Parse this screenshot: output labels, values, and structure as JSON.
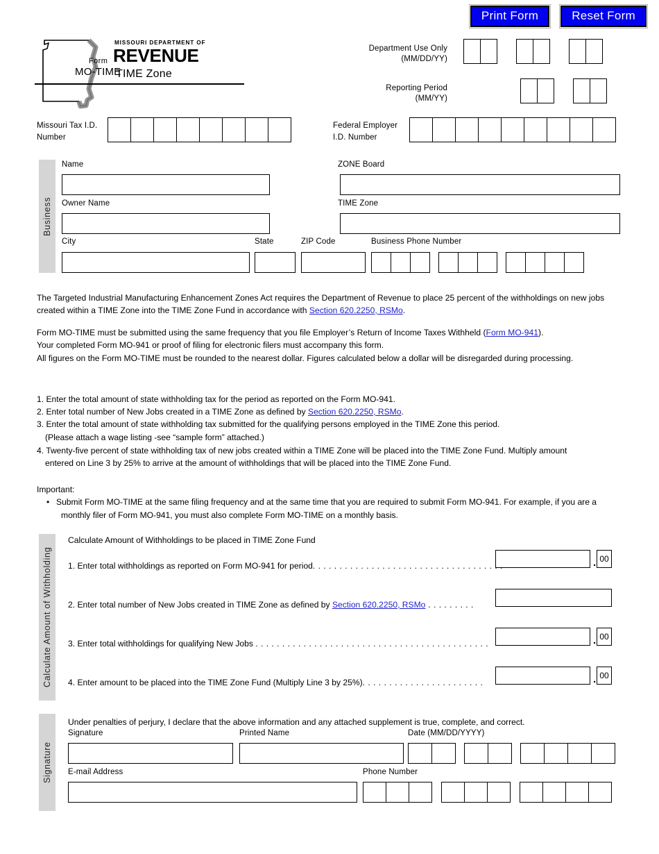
{
  "buttons": {
    "print": "Print Form",
    "reset": "Reset Form"
  },
  "masthead": {
    "form_word": "Form",
    "form_id": "MO-TIME",
    "agency_small": "MISSOURI DEPARTMENT OF",
    "agency_big": "REVENUE",
    "form_title": "TIME Zone"
  },
  "header": {
    "dept_use_label": "Department Use Only",
    "dept_use_format": "(MM/DD/YY)",
    "reporting_period_label": "Reporting Period",
    "reporting_period_format": "(MM/YY)",
    "mo_tax_id_label_line1": "Missouri Tax I.D.",
    "mo_tax_id_label_line2": "Number",
    "fein_label_line1": "Federal Employer",
    "fein_label_line2": "I.D. Number",
    "mo_tax_id_boxes": 8,
    "fein_boxes": 9,
    "dept_use_groups": [
      2,
      2,
      2
    ],
    "reporting_period_groups": [
      2,
      2
    ]
  },
  "business": {
    "tab_label": "Business",
    "name_label": "Name",
    "zone_board_label": "ZONE Board",
    "owner_name_label": "Owner Name",
    "time_zone_label": "TIME Zone",
    "city_label": "City",
    "state_label": "State",
    "zip_label": "ZIP Code",
    "phone_label": "Business Phone Number",
    "phone_groups": [
      3,
      3,
      4
    ]
  },
  "intro": {
    "p1_a": "The Targeted Industrial Manufacturing Enhancement Zones Act requires the Department of Revenue to place 25 percent of the withholdings on new jobs created within a TIME Zone into the TIME Zone Fund in accordance with ",
    "p1_link": "Section 620.2250, RSMo",
    "p1_b": ".",
    "p2_a": "Form MO-TIME must be submitted using the same frequency that you file Employer’s Return of Income Taxes Withheld (",
    "p2_link": "Form MO-941",
    "p2_b": ").",
    "p3": "Your completed Form MO-941 or proof of filing for electronic filers must accompany this form.",
    "p4": "All figures on the Form MO-TIME must be rounded to the nearest dollar. Figures calculated below a dollar will be disregarded during processing."
  },
  "instructions": {
    "i1": "1. Enter the total amount of state withholding tax for the period as reported on the Form MO-941.",
    "i2_a": "2. Enter total number of New Jobs created in a TIME Zone as defined by ",
    "i2_link": "Section 620.2250, RSMo",
    "i2_b": ".",
    "i3": "3. Enter the total amount of state withholding tax submitted for the qualifying persons employed in the TIME Zone this period.",
    "i3_sub": "(Please attach a wage listing -see “sample form” attached.)",
    "i4_line1": "4. Twenty-five percent of state withholding tax of new jobs created within a TIME Zone will be placed into the TIME Zone Fund. Multiply amount",
    "i4_line2": "entered on Line 3 by 25% to arrive at the amount of withholdings that will be placed into the TIME Zone Fund."
  },
  "important": {
    "heading": "Important:",
    "bullet_line1": "Submit Form MO-TIME at the same filing frequency and at the same time that you are required to submit Form MO-941. For example, if you are a",
    "bullet_line2": "monthly filer of Form MO-941, you must also complete Form MO-TIME on a monthly basis."
  },
  "calculate": {
    "tab_label": "Calculate Amount of Withholding",
    "heading": "Calculate Amount of Withholdings to be placed in TIME Zone Fund",
    "cents": "00",
    "lines": [
      {
        "text_a": "1. Enter total withholdings as reported on Form MO-941 for period",
        "link": "",
        "text_b": "",
        "dots": ". . . . . . . . . . . . . . . . . . . . . . . . . . . . . . . . . . . .",
        "has_cents": true
      },
      {
        "text_a": "2. Enter total number of New Jobs created in TIME Zone as defined by ",
        "link": "Section 620.2250, RSMo",
        "text_b": "",
        "dots": " . . . . . . . . .",
        "has_cents": false
      },
      {
        "text_a": "3. Enter total withholdings for qualifying New Jobs ",
        "link": "",
        "text_b": "",
        "dots": ". . . . . . . . . . . . . . . . . . . . . . . . . . . . . . . . . . . . . . . . . . . .",
        "has_cents": true
      },
      {
        "text_a": "4. Enter amount to be placed into the TIME Zone Fund (Multiply Line 3 by 25%)",
        "link": "",
        "text_b": "",
        "dots": ". . . . . . . . . . . . . . . . . . . . . . .",
        "has_cents": true
      }
    ]
  },
  "signature": {
    "tab_label": "Signature",
    "perjury": "Under penalties of perjury, I declare that the above information and any attached supplement is true, complete, and correct.",
    "signature_label": "Signature",
    "printed_name_label": "Printed Name",
    "date_label": "Date (MM/DD/YYYY)",
    "email_label": "E-mail Address",
    "phone_label": "Phone Number",
    "date_groups": [
      2,
      2,
      4
    ],
    "phone_groups": [
      3,
      3,
      4
    ]
  },
  "colors": {
    "button_bg": "#0000ee",
    "link": "#2121c8",
    "tab_bg": "#d5d5d5"
  }
}
